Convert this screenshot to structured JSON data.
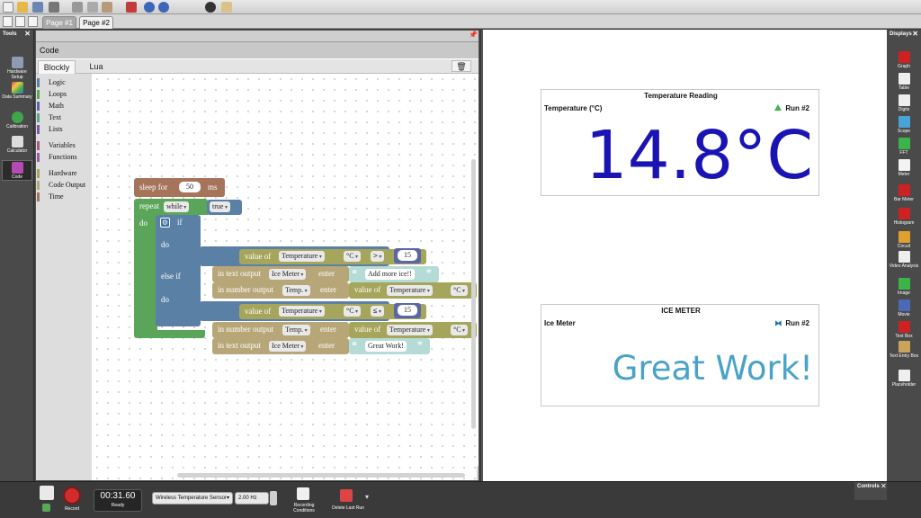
{
  "pages": {
    "tab1": "Page #1",
    "tab2": "Page #2"
  },
  "tools": {
    "title": "Tools",
    "items": [
      "Hardware Setup",
      "Data Summary",
      "Calibration",
      "Calculator",
      "Code"
    ]
  },
  "code_window": {
    "title": "Code",
    "tab_blockly": "Blockly",
    "tab_lua": "Lua",
    "categories": [
      "Logic",
      "Loops",
      "Math",
      "Text",
      "Lists",
      "Variables",
      "Functions",
      "Hardware",
      "Code Output",
      "Time"
    ]
  },
  "blocks": {
    "sleep_for": "sleep for",
    "sleep_value": "50",
    "sleep_unit": "ms",
    "repeat": "repeat",
    "while": "while",
    "true_val": "true",
    "do": "do",
    "if": "if",
    "else_if": "else if",
    "value_of": "value of",
    "temperature": "Temperature",
    "unit_c": "°C",
    "op_gt": ">",
    "op_le": "≤",
    "threshold": "15",
    "in_text_output": "in text output",
    "in_number_output": "in number output",
    "ice_meter": "Ice Meter",
    "temp_short": "Temp.",
    "enter": "enter",
    "msg_add_ice": "Add more ice!!",
    "msg_great": "Great Work!",
    "quote_open": "❝",
    "quote_close": "❞"
  },
  "display1": {
    "title": "Temperature Reading",
    "subtitle": "Temperature (°C)",
    "run": "Run #2",
    "value": "14.8°C",
    "value_color": "#1a14b3"
  },
  "display2": {
    "title": "ICE METER",
    "subtitle": "Ice Meter",
    "run": "Run #2",
    "value": "Great Work!",
    "value_color": "#4aa3c7"
  },
  "displays_bar": {
    "title": "Displays",
    "items": [
      "Graph",
      "Table",
      "Digits",
      "Scope",
      "FFT",
      "Meter",
      "Bar Meter",
      "Histogram",
      "Circuit",
      "Video Analysis",
      "Image",
      "Movie",
      "Text Box",
      "Text Entry Box",
      "Placeholder"
    ]
  },
  "controls": {
    "title": "Controls",
    "record": "Record",
    "timer": "00:31.60",
    "status": "Ready",
    "sensor": "Wireless Temperature Sensor",
    "rate": "2.00 Hz",
    "recording_conditions": "Recording Conditions",
    "delete_last_run": "Delete Last Run"
  },
  "colors": {
    "time_block": "#a5745b",
    "loop_block": "#5ba55b",
    "logic_block": "#5b80a5",
    "hardware_block": "#a5a55b",
    "output_block": "#b7a677",
    "text_block": "#b5dbd6",
    "display1_accent": "#3bb54a",
    "display2_accent": "#1a6fb3"
  }
}
